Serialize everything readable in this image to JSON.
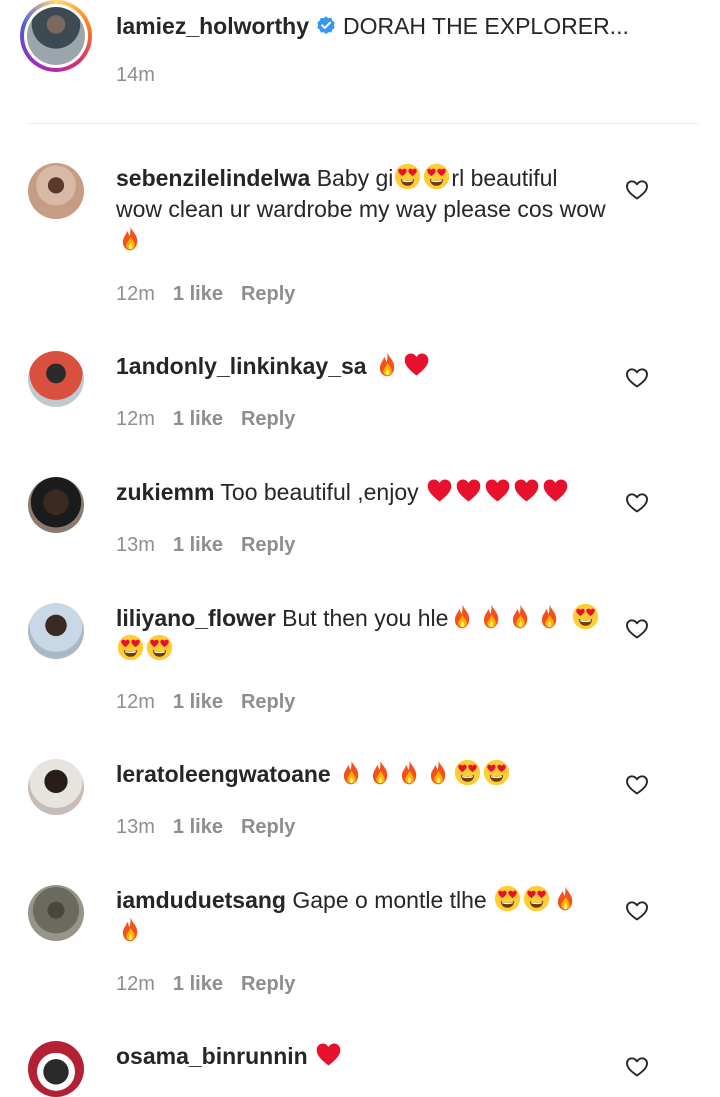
{
  "caption": {
    "username": "lamiez_holworthy",
    "text": "DORAH THE EXPLORER...",
    "time": "14m"
  },
  "comments": [
    {
      "username": "sebenzilelindelwa",
      "text_a": "Baby gi",
      "text_b": "rl beautiful wow clean ur wardrobe my way please cos wow",
      "time": "12m",
      "likes": "1 like",
      "reply": "Reply"
    },
    {
      "username": "1andonly_linkinkay_sa",
      "text": "",
      "time": "12m",
      "likes": "1 like",
      "reply": "Reply"
    },
    {
      "username": "zukiemm",
      "text": "Too beautiful ,enjoy",
      "time": "13m",
      "likes": "1 like",
      "reply": "Reply"
    },
    {
      "username": "liliyano_flower",
      "text": "But then you hle",
      "time": "12m",
      "likes": "1 like",
      "reply": "Reply"
    },
    {
      "username": "leratoleengwatoane",
      "text": "",
      "time": "13m",
      "likes": "1 like",
      "reply": "Reply"
    },
    {
      "username": "iamduduetsang",
      "text": "Gape o montle tlhe",
      "time": "12m",
      "likes": "1 like",
      "reply": "Reply"
    },
    {
      "username": "osama_binrunnin",
      "text": ""
    }
  ],
  "icons": {
    "verified": "verified-badge-icon",
    "like": "heart-outline-icon",
    "emoji_fire": "fire-emoji",
    "emoji_heart": "red-heart-emoji",
    "emoji_heart_eyes": "heart-eyes-emoji"
  },
  "colors": {
    "text": "#262626",
    "secondary": "#8e8e8e",
    "verified": "#3897f0",
    "divider": "#ececec"
  }
}
